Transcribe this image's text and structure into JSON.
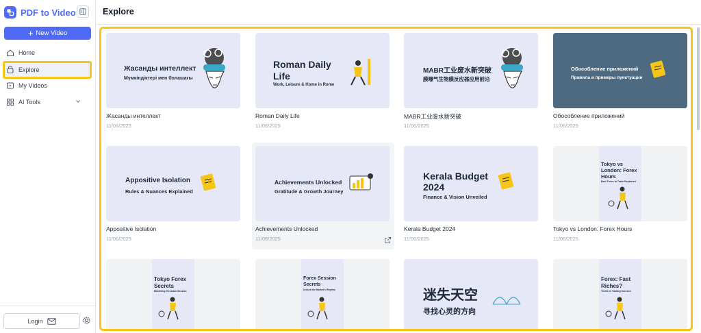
{
  "app": {
    "name": "PDF to Video",
    "accent": "#4f6bf5",
    "highlight": "#f5c518"
  },
  "sidebar": {
    "new_video_label": "New Video",
    "items": [
      {
        "label": "Home",
        "icon": "home-icon"
      },
      {
        "label": "Explore",
        "icon": "explore-icon",
        "active": true
      },
      {
        "label": "My Videos",
        "icon": "my-videos-icon"
      },
      {
        "label": "AI Tools",
        "icon": "ai-tools-icon"
      }
    ],
    "login_label": "Login"
  },
  "main": {
    "title": "Explore",
    "cards": [
      {
        "title": "Жасанды интеллект",
        "date": "11/06/2025",
        "thumb_title": "Жасанды интеллект",
        "thumb_sub": "Мүмкіндіктері мен болашағы"
      },
      {
        "title": "Roman Daily Life",
        "date": "11/06/2025",
        "thumb_title": "Roman Daily",
        "thumb_title2": "Life",
        "thumb_sub": "Work, Leisure & Home in Rome"
      },
      {
        "title": "MABR工业废水新突破",
        "date": "11/06/2025",
        "thumb_title": "MABR工业废水新突破",
        "thumb_sub": "膜曝气生物膜反应器应用前沿"
      },
      {
        "title": "Обособление приложений",
        "date": "11/06/2025",
        "thumb_title": "Обособление приложений",
        "thumb_sub": "Правила и примеры пунктуации"
      },
      {
        "title": "Appositive Isolation",
        "date": "11/06/2025",
        "thumb_title": "Appositive Isolation",
        "thumb_sub": "Rules & Nuances Explained"
      },
      {
        "title": "Achievements Unlocked",
        "date": "11/06/2025",
        "thumb_title": "Achievements Unlocked",
        "thumb_sub": "Gratitude & Growth Journey"
      },
      {
        "title": "Kerala Budget 2024",
        "date": "11/06/2025",
        "thumb_title": "Kerala Budget",
        "thumb_title2": "2024",
        "thumb_sub": "Finance & Vision Unveiled"
      },
      {
        "title": "Tokyo vs London: Forex Hours",
        "date": "11/06/2025",
        "thumb_title": "Tokyo vs",
        "thumb_title2": "London: Forex",
        "thumb_title3": "Hours",
        "thumb_sub": "Best Times to Trade Explained"
      },
      {
        "thumb_title": "Tokyo Forex",
        "thumb_title2": "Secrets",
        "thumb_sub": "Mastering the Asian Session"
      },
      {
        "thumb_title": "Forex Session",
        "thumb_title2": "Secrets",
        "thumb_sub": "Unlock the Market's Rhythm"
      },
      {
        "thumb_title": "迷失天空",
        "thumb_sub": "寻找心灵的方向"
      },
      {
        "thumb_title": "Forex: Fast",
        "thumb_title2": "Riches?",
        "thumb_sub": "Truths of Trading Success"
      }
    ]
  }
}
